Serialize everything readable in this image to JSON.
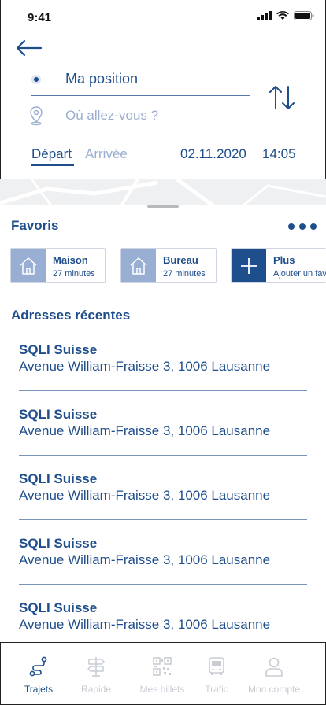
{
  "status_bar": {
    "time": "9:41"
  },
  "search": {
    "origin": "Ma position",
    "destination_placeholder": "Où allez-vous ?",
    "tabs": [
      "Départ",
      "Arrivée"
    ],
    "active_tab": "Départ",
    "date": "02.11.2020",
    "time": "14:05"
  },
  "favorites": {
    "title": "Favoris",
    "items": [
      {
        "name": "Maison",
        "sub": "27 minutes",
        "icon": "home-icon"
      },
      {
        "name": "Bureau",
        "sub": "27 minutes",
        "icon": "home-icon"
      },
      {
        "name": "Plus",
        "sub": "Ajouter un favori",
        "icon": "plus-icon"
      }
    ]
  },
  "recent": {
    "title": "Adresses récentes",
    "items": [
      {
        "name": "SQLI Suisse",
        "address": "Avenue William-Fraisse 3, 1006 Lausanne"
      },
      {
        "name": "SQLI Suisse",
        "address": "Avenue William-Fraisse 3, 1006 Lausanne"
      },
      {
        "name": "SQLI Suisse",
        "address": "Avenue William-Fraisse 3, 1006 Lausanne"
      },
      {
        "name": "SQLI Suisse",
        "address": "Avenue William-Fraisse 3, 1006 Lausanne"
      },
      {
        "name": "SQLI Suisse",
        "address": "Avenue William-Fraisse 3, 1006 Lausanne"
      }
    ]
  },
  "nav": {
    "items": [
      {
        "label": "Trajets",
        "icon": "route-icon",
        "active": true
      },
      {
        "label": "Rapide",
        "icon": "signpost-icon",
        "active": false
      },
      {
        "label": "Mes billets",
        "icon": "qr-code-icon",
        "active": false
      },
      {
        "label": "Trafic",
        "icon": "bus-icon",
        "active": false
      },
      {
        "label": "Mon compte",
        "icon": "user-icon",
        "active": false
      }
    ]
  },
  "colors": {
    "primary": "#1f4e8c",
    "light": "#98aed3",
    "muted": "#9aaed0",
    "inactive": "#c9cdd3"
  }
}
